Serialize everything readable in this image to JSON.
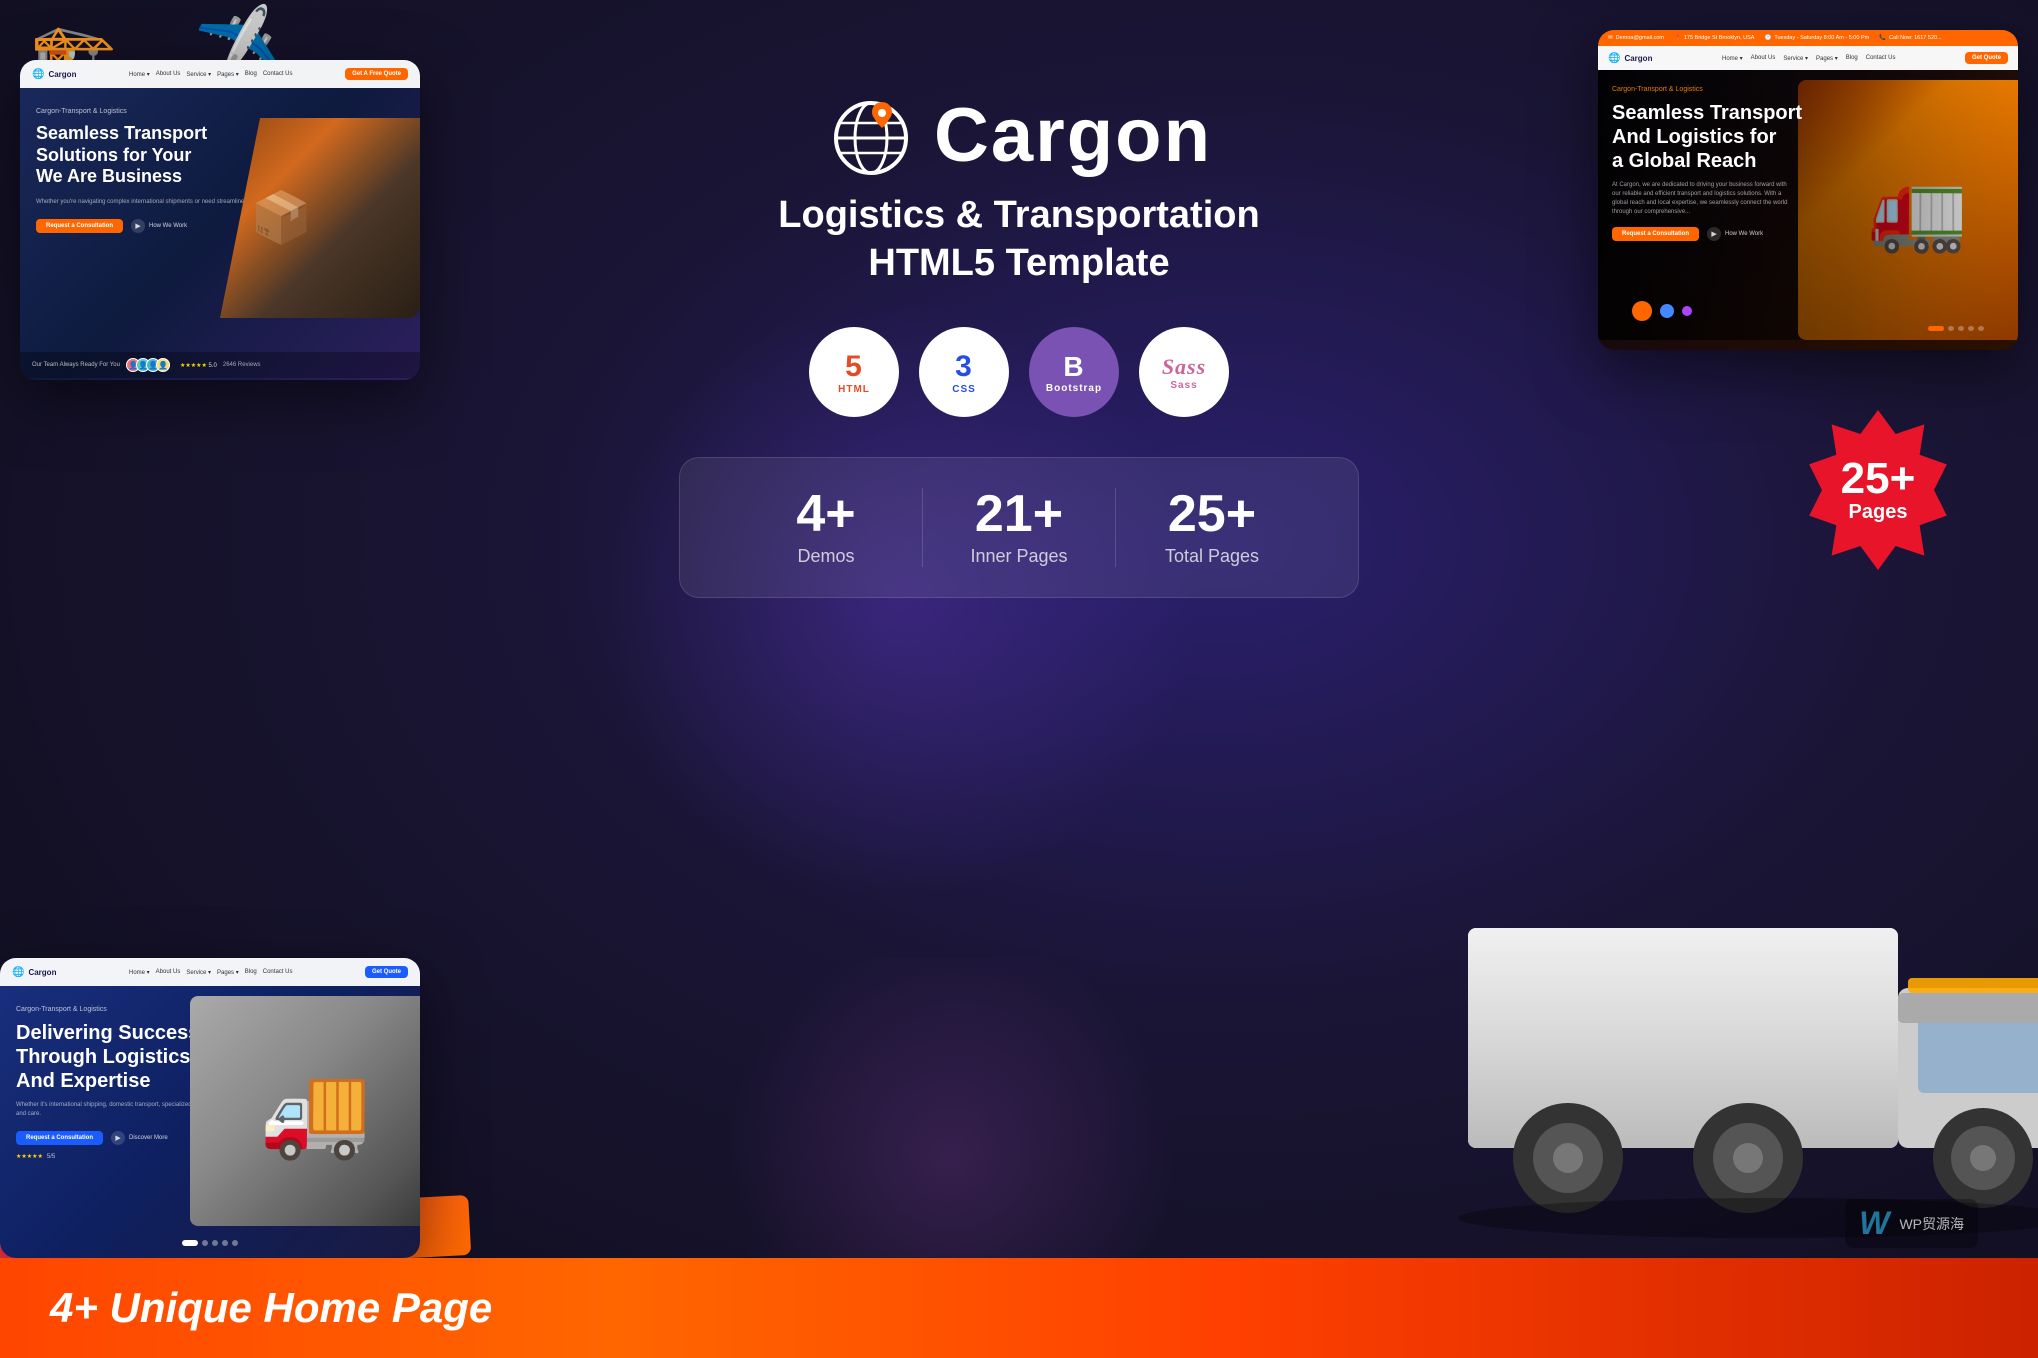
{
  "page": {
    "title": "Cargon - Logistics & Transportation HTML5 Template",
    "background_color": "#1a1535"
  },
  "logo": {
    "name": "Cargon",
    "icon": "🌐"
  },
  "headline": {
    "line1": "Logistics & Transportation",
    "line2": "HTML5 Template"
  },
  "tech_badges": [
    {
      "top": "HTML",
      "num": "5",
      "label": "HTML"
    },
    {
      "top": "CSS",
      "num": "3",
      "label": "CSS"
    },
    {
      "label": "B",
      "sublabel": "Bootstrap"
    },
    {
      "label": "Sass",
      "sublabel": "Sass"
    }
  ],
  "stats": [
    {
      "number": "4+",
      "label": "Demos"
    },
    {
      "number": "21+",
      "label": "Inner Pages"
    },
    {
      "number": "25+",
      "label": "Total Pages"
    }
  ],
  "pages_badge": {
    "number": "25+",
    "label": "Pages"
  },
  "bottom_bar": {
    "text": "4+ Unique Home Page"
  },
  "preview_cards": {
    "top_left": {
      "navbar": {
        "logo": "Cargon",
        "links": [
          "Home",
          "About Us",
          "Service",
          "Pages",
          "Blog",
          "Contact Us"
        ],
        "cta": "Get A Free Quote"
      },
      "hero": {
        "label": "Cargon-Transport & Logistics",
        "title": "Seamless Transport Solutions for Your We Are Business",
        "desc": "Whether you're navigating complex international shipments or need streamlined local deliveries, we are your trusted partner...",
        "btn1": "Request a Consultation",
        "btn2": "How We Work",
        "team_label": "Our Team Always Ready For You",
        "rating": "5.0",
        "reviews": "2646 Reviews"
      }
    },
    "top_right": {
      "topbar": {
        "email": "Demoa@gmail.com",
        "address": "175 Bridge St Brooklyn, USA",
        "hours": "Tuesday - Saturday 8:00 Am - 5:00 Pm",
        "phone": "Call Now: 1617 520..."
      },
      "navbar": {
        "logo": "Cargon",
        "links": [
          "Home",
          "About Us",
          "Service",
          "Pages",
          "Blog",
          "Contact Us"
        ],
        "cta": "Get Quote"
      },
      "hero": {
        "label": "Cargon-Transport & Logistics",
        "title": "Seamless Transport And Logistics for a Global Reach",
        "desc": "At Cargon, we are dedicated to driving your business forward with our reliable and efficient transport and logistics solutions.",
        "btn1": "Request a Consultation",
        "btn2": "How We Work"
      }
    },
    "bottom_left": {
      "navbar": {
        "logo": "Cargon",
        "links": [
          "Home",
          "About Us",
          "Service",
          "Pages",
          "Blog",
          "Contact Us"
        ],
        "cta": "Get Quote"
      },
      "hero": {
        "label": "Cargon-Transport & Logistics",
        "title": "Delivering Success Through Logistics And Expertise",
        "btn1": "Request a Consultation",
        "btn2": "Discover More",
        "rating": "5/5"
      }
    }
  },
  "watermark": {
    "wp_icon": "W",
    "text": "WP贸源海"
  }
}
